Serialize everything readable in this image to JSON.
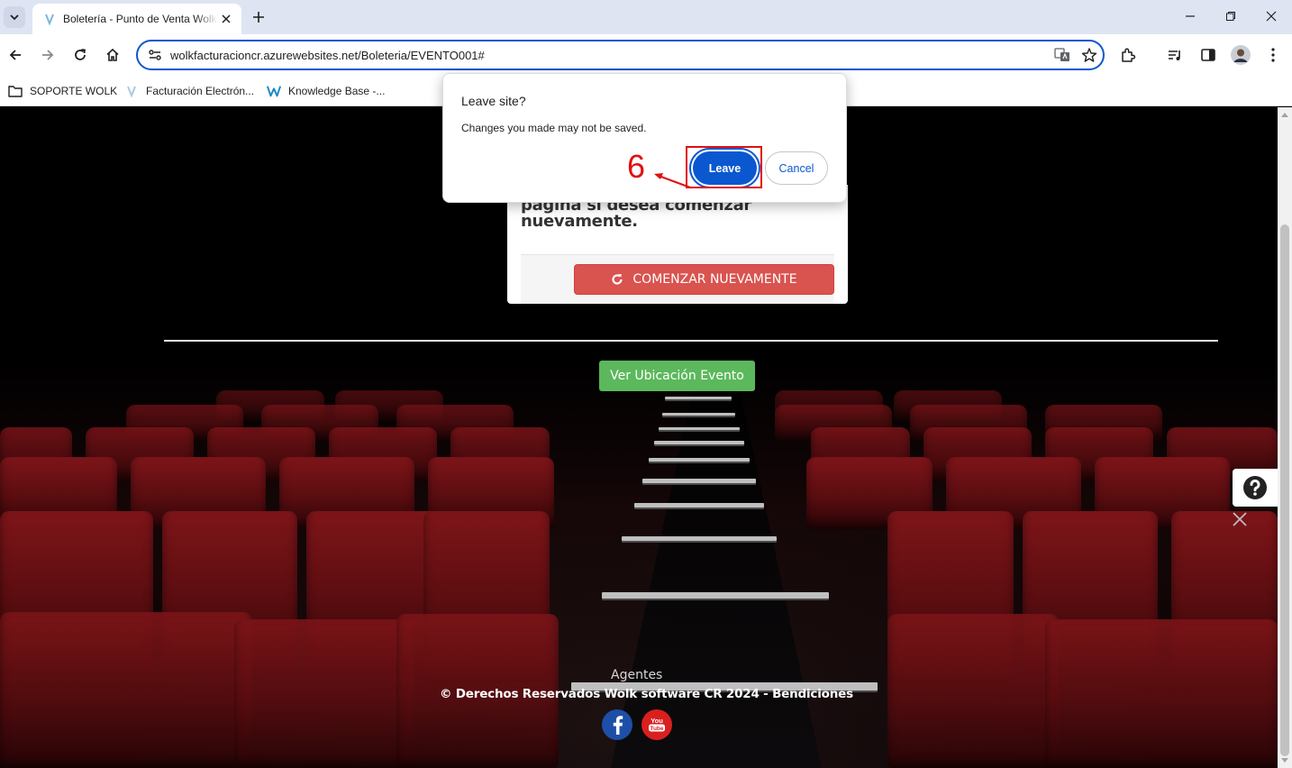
{
  "browser": {
    "tab": {
      "title": "Boletería - Punto de Venta Wolk"
    },
    "address_bar": {
      "url": "wolkfacturacioncr.azurewebsites.net/Boleteria/EVENTO001#"
    },
    "bookmarks": [
      {
        "label": "SOPORTE WOLK",
        "icon": "folder-icon"
      },
      {
        "label": "Facturación Electrón...",
        "icon": "page-icon"
      },
      {
        "label": "Knowledge Base -...",
        "icon": "wolk-logo-icon"
      }
    ]
  },
  "dialog": {
    "title": "Leave site?",
    "message": "Changes you made may not be saved.",
    "leave_label": "Leave",
    "cancel_label": "Cancel"
  },
  "annotation": {
    "step_number": "6",
    "color": "#e01010"
  },
  "page": {
    "card_message": "página si desea comenzar nuevamente.",
    "restart_button": "COMENZAR NUEVAMENTE",
    "location_button": "Ver Ubicación Evento",
    "agents_label": "Agentes",
    "copyright": "©  Derechos Reservados Wolk software CR  2024 - Bendiciones",
    "social": [
      "facebook-icon",
      "youtube-icon"
    ]
  },
  "colors": {
    "accent": "#0b57d0",
    "restart_button": "#d9534f",
    "location_button": "#5cb85c",
    "seat_red": "#7e1519"
  }
}
